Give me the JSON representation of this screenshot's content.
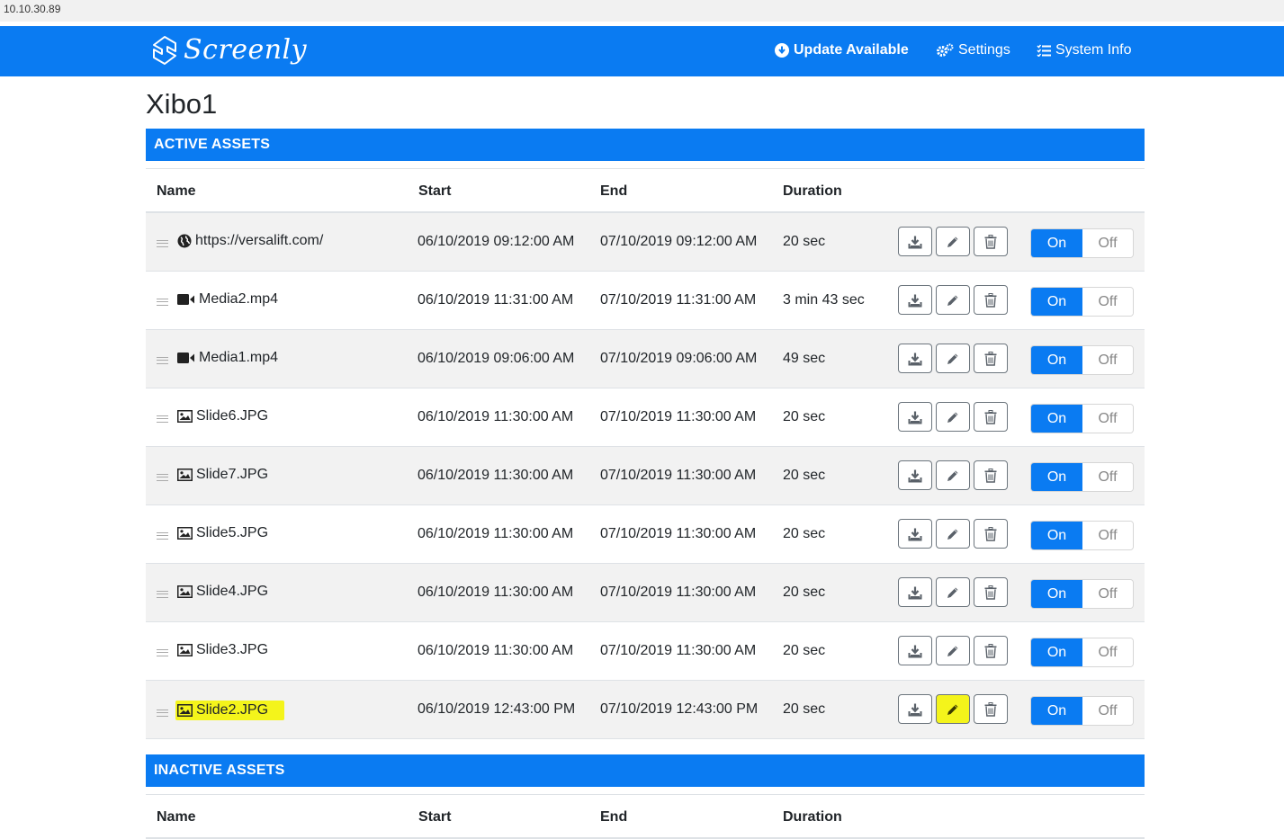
{
  "browser": {
    "address": "10.10.30.89"
  },
  "navbar": {
    "brand": "Screenly",
    "update_label": "Update Available",
    "settings_label": "Settings",
    "sysinfo_label": "System Info"
  },
  "page": {
    "title": "Xibo1"
  },
  "active_section": {
    "title": "ACTIVE ASSETS"
  },
  "inactive_section": {
    "title": "INACTIVE ASSETS"
  },
  "columns": {
    "name": "Name",
    "start": "Start",
    "end": "End",
    "duration": "Duration"
  },
  "toggle": {
    "on": "On",
    "off": "Off"
  },
  "assets": [
    {
      "type": "globe-icon",
      "name": "https://versalift.com/",
      "start": "06/10/2019 09:12:00 AM",
      "end": "07/10/2019 09:12:00 AM",
      "duration": "20 sec",
      "enabled": true
    },
    {
      "type": "video-icon",
      "name": "Media2.mp4",
      "start": "06/10/2019 11:31:00 AM",
      "end": "07/10/2019 11:31:00 AM",
      "duration": "3 min 43 sec",
      "enabled": true
    },
    {
      "type": "video-icon",
      "name": "Media1.mp4",
      "start": "06/10/2019 09:06:00 AM",
      "end": "07/10/2019 09:06:00 AM",
      "duration": "49 sec",
      "enabled": true
    },
    {
      "type": "image-icon",
      "name": "Slide6.JPG",
      "start": "06/10/2019 11:30:00 AM",
      "end": "07/10/2019 11:30:00 AM",
      "duration": "20 sec",
      "enabled": true
    },
    {
      "type": "image-icon",
      "name": "Slide7.JPG",
      "start": "06/10/2019 11:30:00 AM",
      "end": "07/10/2019 11:30:00 AM",
      "duration": "20 sec",
      "enabled": true
    },
    {
      "type": "image-icon",
      "name": "Slide5.JPG",
      "start": "06/10/2019 11:30:00 AM",
      "end": "07/10/2019 11:30:00 AM",
      "duration": "20 sec",
      "enabled": true
    },
    {
      "type": "image-icon",
      "name": "Slide4.JPG",
      "start": "06/10/2019 11:30:00 AM",
      "end": "07/10/2019 11:30:00 AM",
      "duration": "20 sec",
      "enabled": true
    },
    {
      "type": "image-icon",
      "name": "Slide3.JPG",
      "start": "06/10/2019 11:30:00 AM",
      "end": "07/10/2019 11:30:00 AM",
      "duration": "20 sec",
      "enabled": true
    },
    {
      "type": "image-icon",
      "name": "Slide2.JPG",
      "start": "06/10/2019 12:43:00 PM",
      "end": "07/10/2019 12:43:00 PM",
      "duration": "20 sec",
      "enabled": true,
      "highlighted": true
    }
  ],
  "colors": {
    "primary": "#0a7bf2",
    "highlight": "#f4f41b",
    "stripe": "#f2f2f2"
  }
}
